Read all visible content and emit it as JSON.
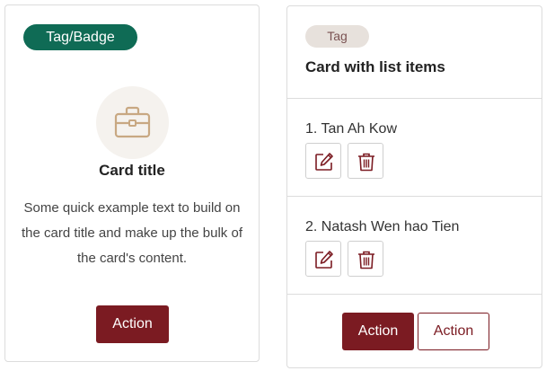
{
  "card1": {
    "badge": "Tag/Badge",
    "icon": "briefcase-icon",
    "title": "Card title",
    "text": "Some quick example text to build on the card title and make up the bulk of the card's content.",
    "action_label": "Action"
  },
  "card2": {
    "tag": "Tag",
    "title": "Card with list items",
    "items": [
      {
        "number": "1.",
        "name": "Tan Ah Kow"
      },
      {
        "number": "2.",
        "name": "Natash Wen hao Tien"
      }
    ],
    "edit_icon": "edit-icon",
    "delete_icon": "trash-icon",
    "primary_action_label": "Action",
    "secondary_action_label": "Action"
  },
  "colors": {
    "badge_green": "#0f6b55",
    "primary": "#7b1b22",
    "tag_bg": "#e7e1dc",
    "icon_gold": "#c8a882"
  }
}
